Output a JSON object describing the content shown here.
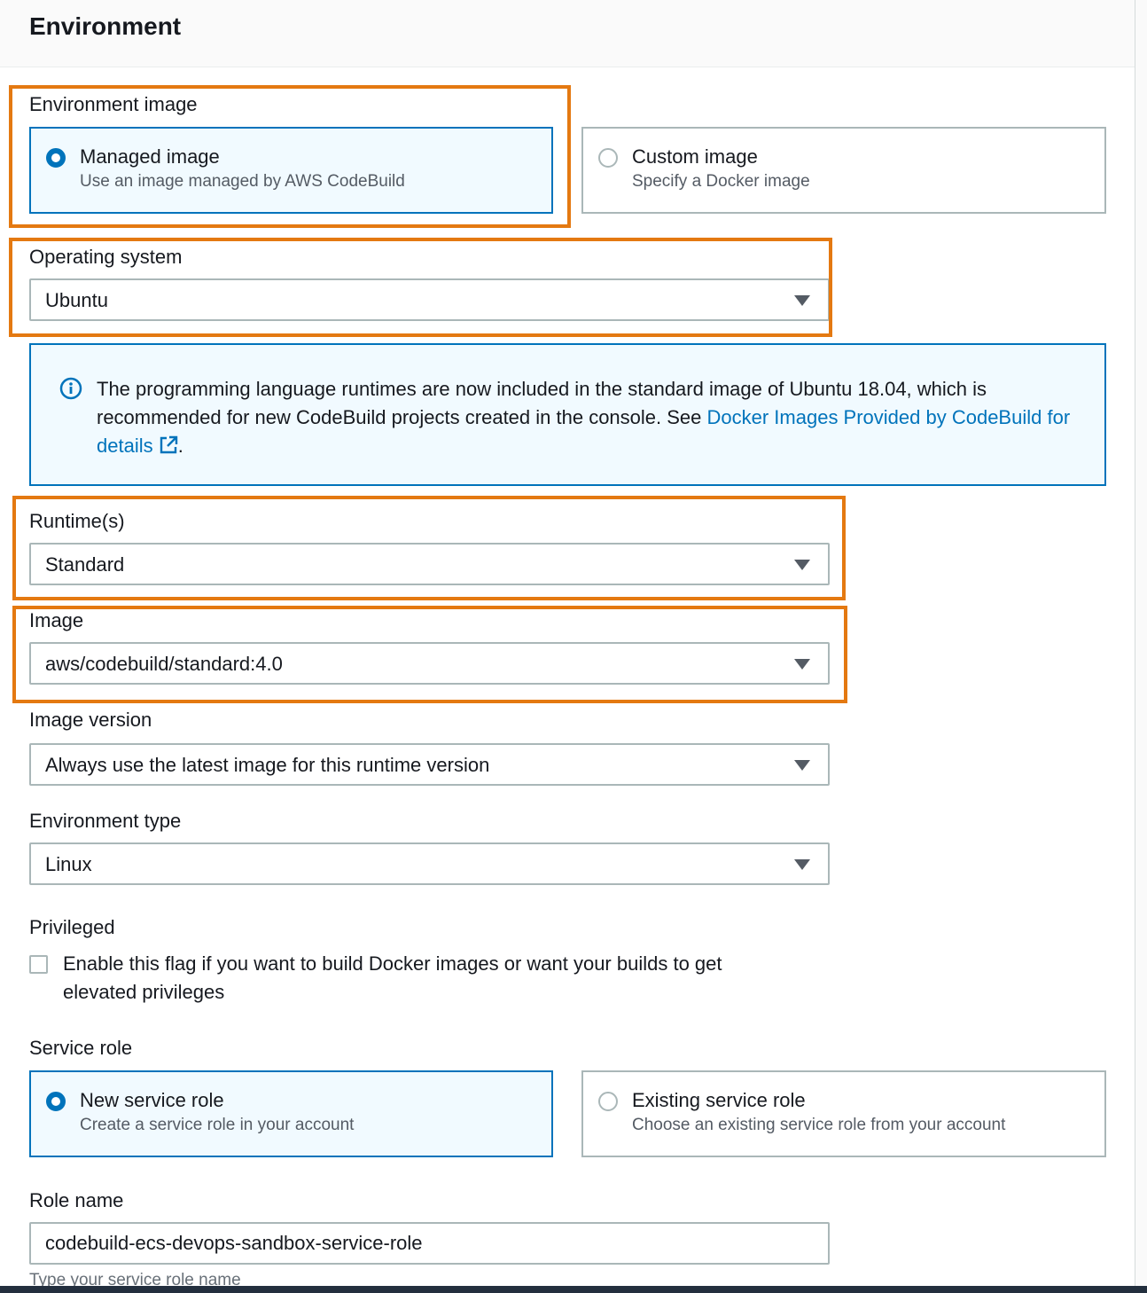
{
  "section": {
    "title": "Environment"
  },
  "environment_image": {
    "label": "Environment image",
    "options": [
      {
        "title": "Managed image",
        "description": "Use an image managed by AWS CodeBuild",
        "selected": true
      },
      {
        "title": "Custom image",
        "description": "Specify a Docker image",
        "selected": false
      }
    ]
  },
  "operating_system": {
    "label": "Operating system",
    "value": "Ubuntu"
  },
  "info_alert": {
    "text": "The programming language runtimes are now included in the standard image of Ubuntu 18.04, which is recommended for new CodeBuild projects created in the console. See ",
    "link_text": "Docker Images Provided by CodeBuild for details",
    "trailing": "."
  },
  "runtimes": {
    "label": "Runtime(s)",
    "value": "Standard"
  },
  "image": {
    "label": "Image",
    "value": "aws/codebuild/standard:4.0"
  },
  "image_version": {
    "label": "Image version",
    "value": "Always use the latest image for this runtime version"
  },
  "environment_type": {
    "label": "Environment type",
    "value": "Linux"
  },
  "privileged": {
    "label": "Privileged",
    "checkbox_text": "Enable this flag if you want to build Docker images or want your builds to get elevated privileges",
    "checked": false
  },
  "service_role": {
    "label": "Service role",
    "options": [
      {
        "title": "New service role",
        "description": "Create a service role in your account",
        "selected": true
      },
      {
        "title": "Existing service role",
        "description": "Choose an existing service role from your account",
        "selected": false
      }
    ]
  },
  "role_name": {
    "label": "Role name",
    "value": "codebuild-ecs-devops-sandbox-service-role",
    "hint": "Type your service role name"
  },
  "colors": {
    "accent": "#0073bb",
    "highlight": "#e47911",
    "border": "#aab7b8"
  }
}
